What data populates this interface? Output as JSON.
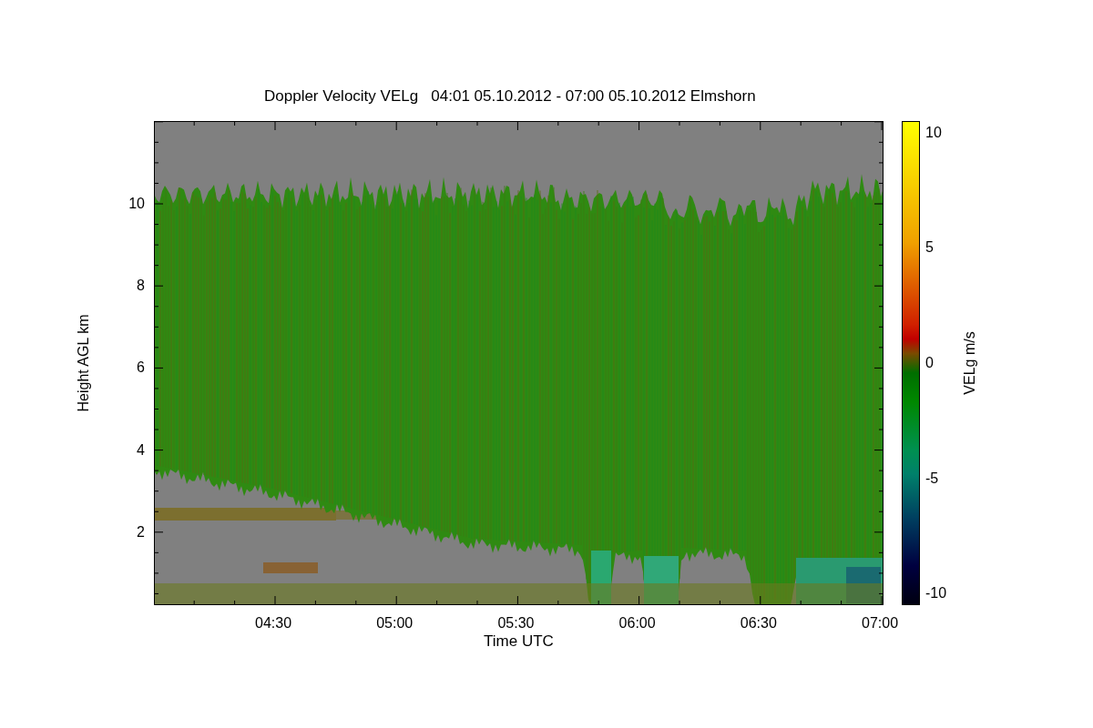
{
  "title": "Doppler Velocity VELg   04:01 05.10.2012 - 07:00 05.10.2012 Elmshorn",
  "x_axis": {
    "label": "Time UTC",
    "ticks": [
      "04:30",
      "05:00",
      "05:30",
      "06:00",
      "06:30",
      "07:00"
    ]
  },
  "y_axis": {
    "label": "Height AGL km",
    "ticks": [
      "10",
      "8",
      "6",
      "4",
      "2"
    ]
  },
  "colorbar": {
    "label": "VELg m/s",
    "ticks": [
      "10",
      "5",
      "0",
      "-5",
      "-10"
    ]
  }
}
